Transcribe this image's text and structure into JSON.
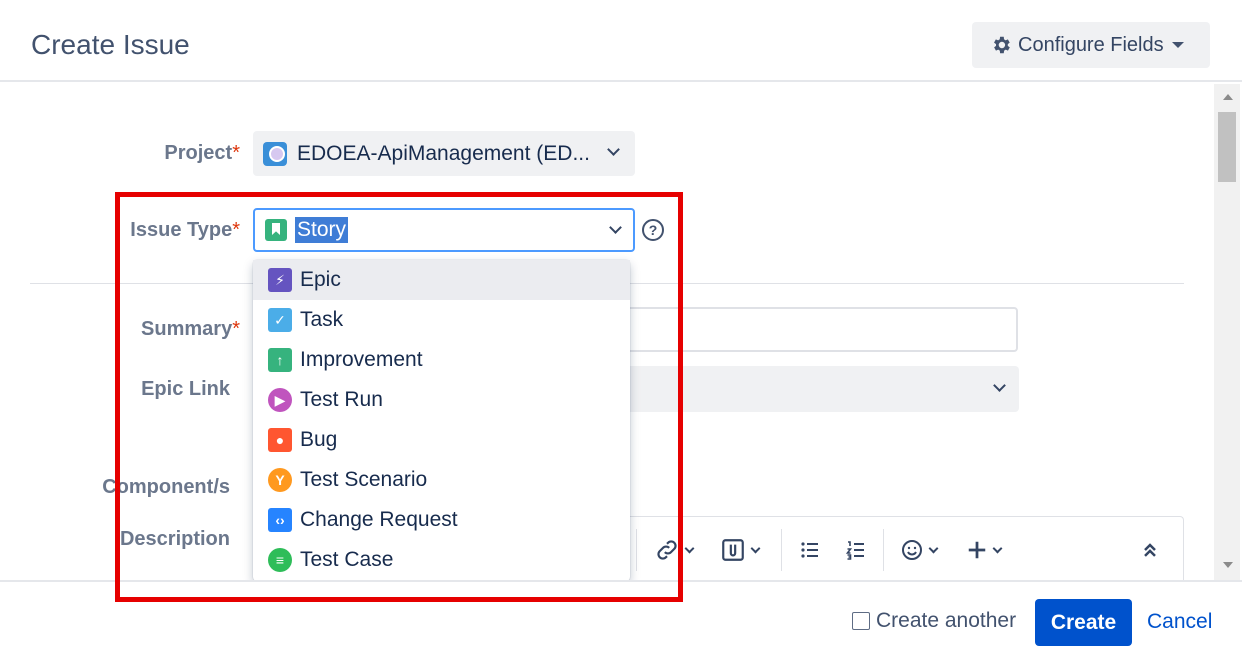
{
  "header": {
    "title": "Create Issue",
    "configure_fields_label": "Configure Fields"
  },
  "form": {
    "project": {
      "label": "Project",
      "required_mark": "*",
      "value": "EDOEA-ApiManagement (ED..."
    },
    "issue_type": {
      "label": "Issue Type",
      "required_mark": "*",
      "value": "Story",
      "help": "?"
    },
    "summary": {
      "label": "Summary",
      "required_mark": "*",
      "value": ""
    },
    "epic_link": {
      "label": "Epic Link",
      "value": ""
    },
    "components": {
      "label": "Component/s"
    },
    "description": {
      "label": "Description"
    }
  },
  "dropdown": {
    "highlighted_index": 0,
    "options": [
      {
        "label": "Epic",
        "icon": "epic-icon",
        "color": "#6554c0"
      },
      {
        "label": "Task",
        "icon": "task-icon",
        "color": "#4bade8"
      },
      {
        "label": "Improvement",
        "icon": "improvement-icon",
        "color": "#36b37e"
      },
      {
        "label": "Test Run",
        "icon": "test-run-icon",
        "color": "#c054be"
      },
      {
        "label": "Bug",
        "icon": "bug-icon",
        "color": "#ff5630"
      },
      {
        "label": "Test Scenario",
        "icon": "test-scenario-icon",
        "color": "#ff991f"
      },
      {
        "label": "Change Request",
        "icon": "change-request-icon",
        "color": "#2684ff"
      },
      {
        "label": "Test Case",
        "icon": "test-case-icon",
        "color": "#2ebd59"
      }
    ]
  },
  "footer": {
    "create_another_label": "Create another",
    "create_another_checked": false,
    "create_label": "Create",
    "cancel_label": "Cancel"
  },
  "colors": {
    "accent": "#0052cc",
    "focus_border": "#4c9aff",
    "highlight_box": "#e60000",
    "required": "#de350b"
  }
}
